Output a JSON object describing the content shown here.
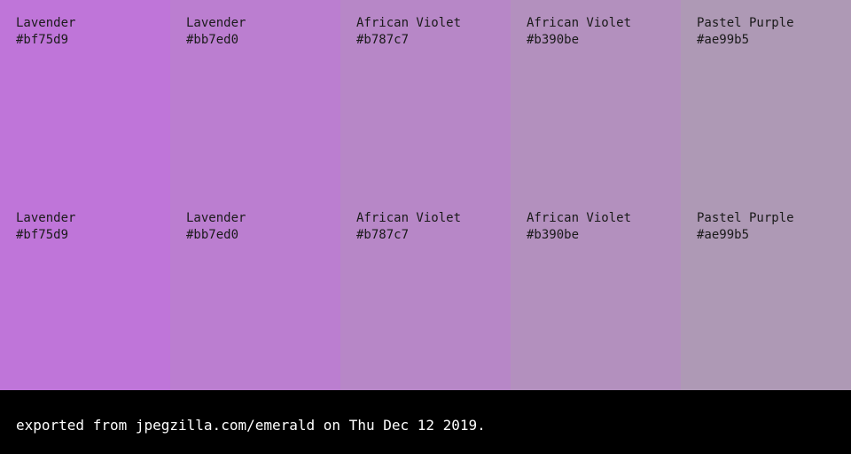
{
  "palette": {
    "rows": [
      {
        "swatches": [
          {
            "name": "Lavender",
            "hex": "#bf75d9",
            "color": "#bf75d9"
          },
          {
            "name": "Lavender",
            "hex": "#bb7ed0",
            "color": "#bb7ed0"
          },
          {
            "name": "African Violet",
            "hex": "#b787c7",
            "color": "#b787c7"
          },
          {
            "name": "African Violet",
            "hex": "#b390be",
            "color": "#b390be"
          },
          {
            "name": "Pastel Purple",
            "hex": "#ae99b5",
            "color": "#ae99b5"
          }
        ]
      },
      {
        "swatches": [
          {
            "name": "Lavender",
            "hex": "#bf75d9",
            "color": "#bf75d9"
          },
          {
            "name": "Lavender",
            "hex": "#bb7ed0",
            "color": "#bb7ed0"
          },
          {
            "name": "African Violet",
            "hex": "#b787c7",
            "color": "#b787c7"
          },
          {
            "name": "African Violet",
            "hex": "#b390be",
            "color": "#b390be"
          },
          {
            "name": "Pastel Purple",
            "hex": "#ae99b5",
            "color": "#ae99b5"
          }
        ]
      }
    ]
  },
  "footer": {
    "text": "exported from jpegzilla.com/emerald on Thu Dec 12 2019.",
    "background": "#000000",
    "text_color": "#ffffff"
  }
}
